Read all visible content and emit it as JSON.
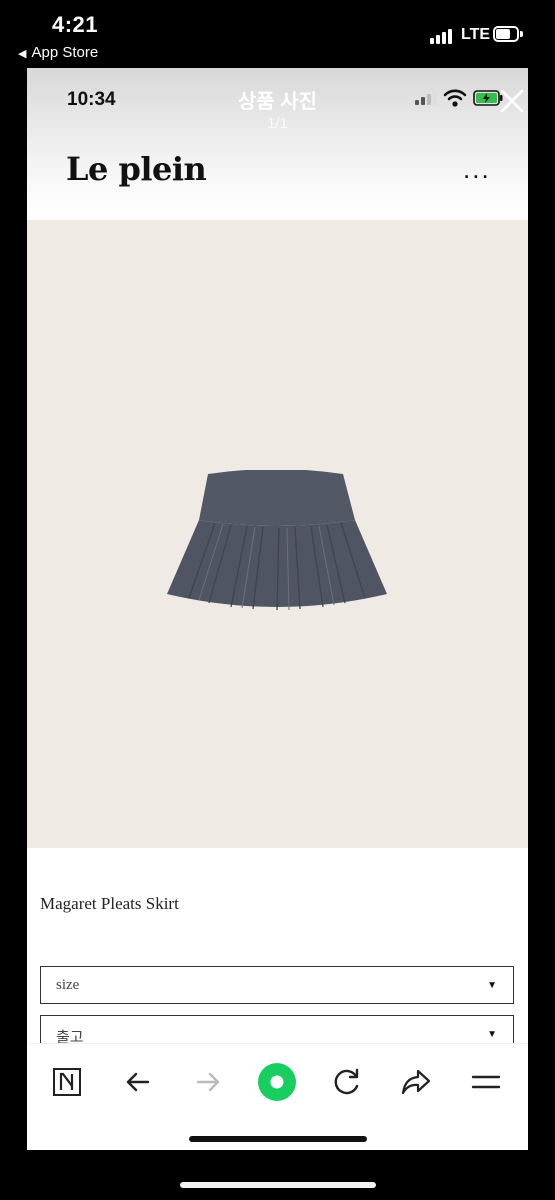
{
  "outer_status": {
    "time": "4:21",
    "back_label": "App Store",
    "network": "LTE"
  },
  "viewer": {
    "inner_time": "10:34",
    "title": "상품 사진",
    "count": "1/1"
  },
  "page": {
    "brand": "Le plein",
    "more_label": "...",
    "product_name": "Magaret Pleats Skirt",
    "selects": [
      {
        "value": "size"
      },
      {
        "value": "출고"
      }
    ],
    "select_arrow": "▼"
  },
  "toolbar": {
    "items": [
      {
        "icon": "naver-n-icon",
        "label": "N"
      },
      {
        "icon": "back-arrow-icon"
      },
      {
        "icon": "forward-arrow-icon"
      },
      {
        "icon": "green-dot-icon"
      },
      {
        "icon": "reload-icon"
      },
      {
        "icon": "share-icon"
      },
      {
        "icon": "menu-icon"
      }
    ]
  },
  "colors": {
    "accent_green": "#19ce60",
    "photo_bg": "#efebe4",
    "skirt": "#505663"
  }
}
